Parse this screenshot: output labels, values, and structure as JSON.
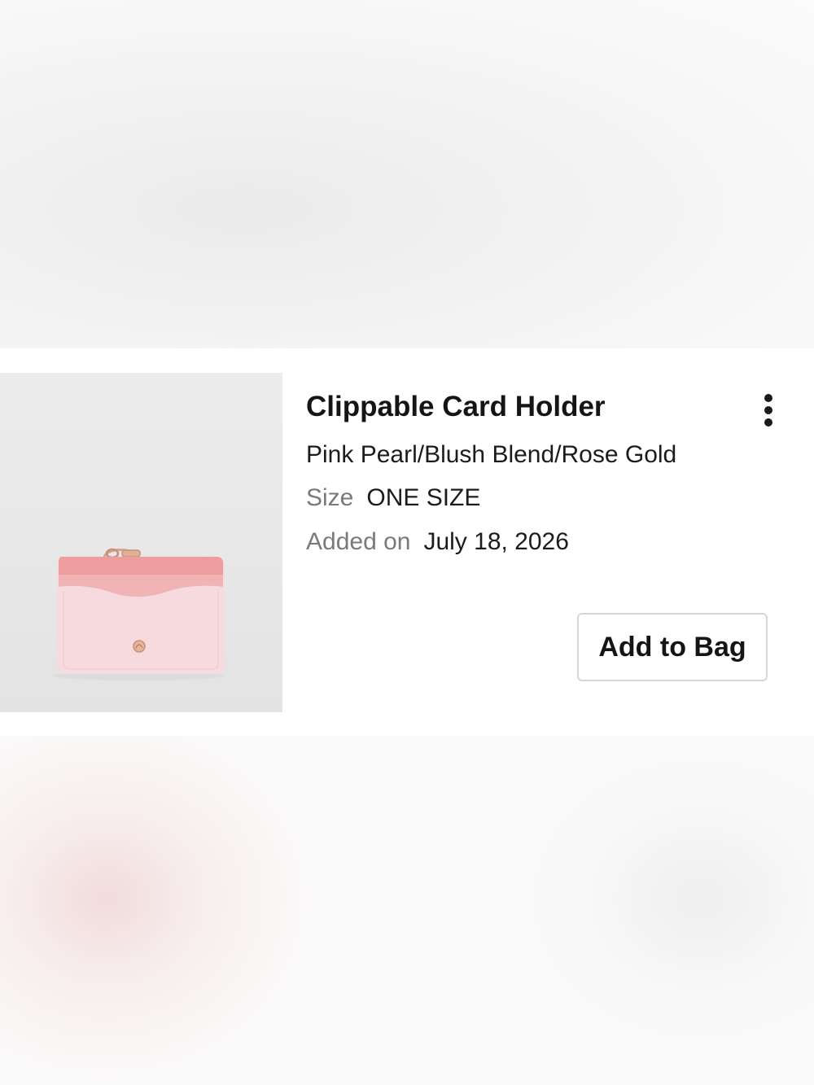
{
  "product": {
    "name": "Clippable Card Holder",
    "color": "Pink Pearl/Blush Blend/Rose Gold",
    "size_label": "Size",
    "size_value": "ONE SIZE",
    "added_label": "Added on",
    "added_value": "July 18, 2026",
    "image_icon": "card-holder-product-image"
  },
  "actions": {
    "add_to_bag_label": "Add to Bag",
    "more_icon": "more-vertical-icon"
  },
  "colors": {
    "card_top_pink": "#f0a3a3",
    "card_body_pink": "#f6dade",
    "hardware_rose_gold": "#d9a48c"
  }
}
